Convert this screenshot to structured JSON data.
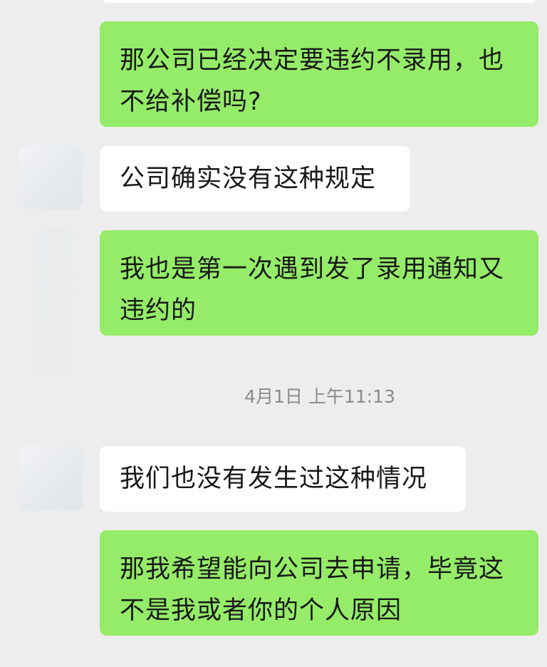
{
  "chat": {
    "timestamp": "4月1日 上午11:13",
    "messages": [
      {
        "sender": "self",
        "text": "那公司已经决定要违约不录用，也不给补偿吗?"
      },
      {
        "sender": "other",
        "text": "公司确实没有这种规定"
      },
      {
        "sender": "self",
        "text": "我也是第一次遇到发了录用通知又违约的"
      },
      {
        "sender": "other",
        "text": "我们也没有发生过这种情况"
      },
      {
        "sender": "self",
        "text": "那我希望能向公司去申请，毕竟这不是我或者你的个人原因"
      }
    ]
  },
  "colors": {
    "background": "#ededed",
    "self_bubble": "#95ec69",
    "other_bubble": "#ffffff",
    "timestamp_text": "#8a8a8a"
  }
}
